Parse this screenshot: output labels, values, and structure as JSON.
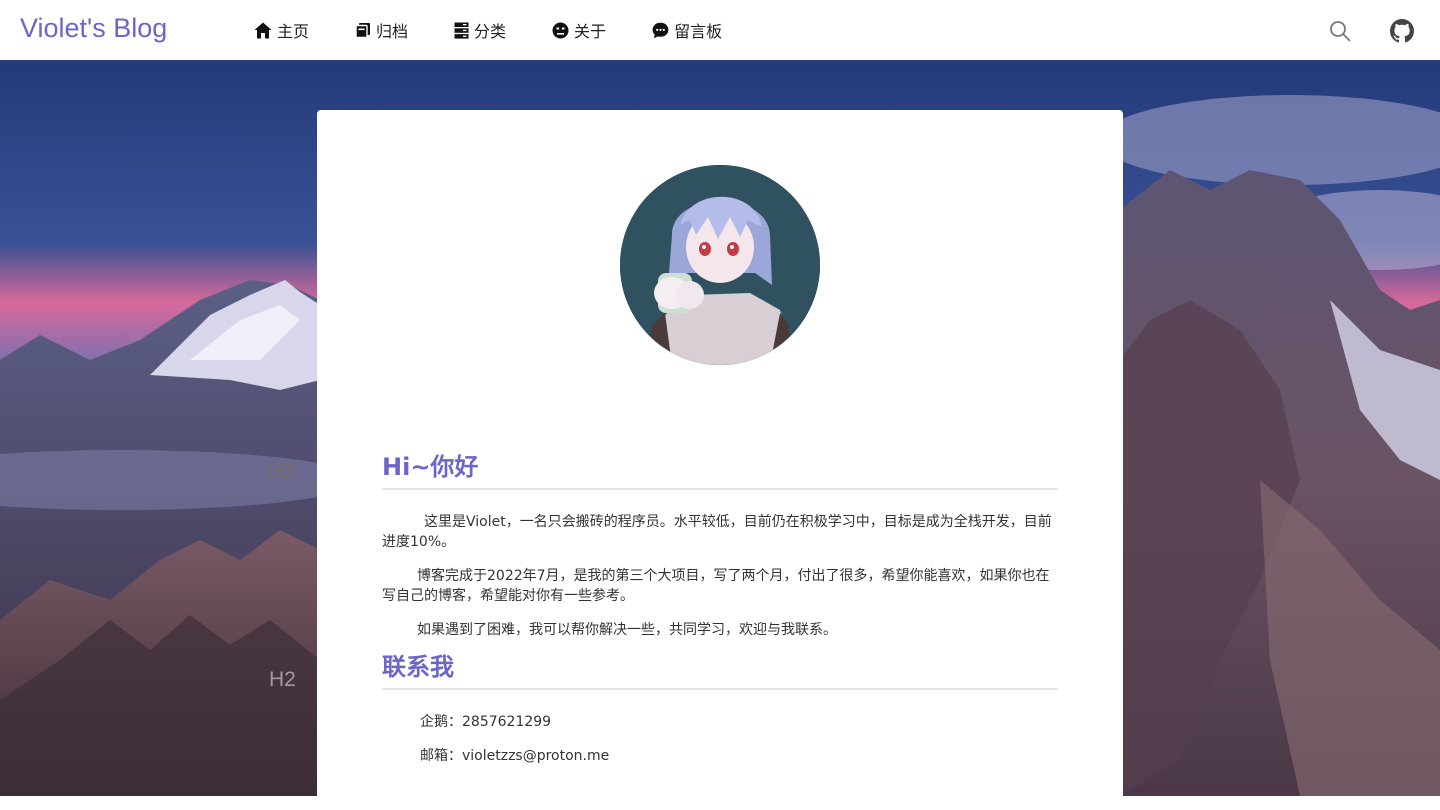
{
  "site": {
    "brand": "Violet's Blog",
    "accent_color": "#6d66c9"
  },
  "nav": {
    "items": [
      {
        "label": "主页",
        "icon": "home-icon"
      },
      {
        "label": "归档",
        "icon": "archive-icon"
      },
      {
        "label": "分类",
        "icon": "category-icon"
      },
      {
        "label": "关于",
        "icon": "face-icon"
      },
      {
        "label": "留言板",
        "icon": "chat-icon"
      }
    ],
    "right_icons": [
      "search-icon",
      "github-icon"
    ]
  },
  "background": {
    "side_headings": [
      "H2",
      "H2"
    ]
  },
  "card": {
    "avatar": "anime-character-avatar",
    "intro": {
      "title": "Hi~你好",
      "paragraphs": [
        "这里是Violet，一名只会搬砖的程序员。水平较低，目前仍在积极学习中，目标是成为全栈开发，目前进度10%。",
        "博客完成于2022年7月，是我的第三个大项目，写了两个月，付出了很多，希望你能喜欢，如果你也在写自己的博客，希望能对你有一些参考。",
        "如果遇到了困难，我可以帮你解决一些，共同学习，欢迎与我联系。"
      ]
    },
    "contact": {
      "title": "联系我",
      "lines": [
        "企鹅：2857621299",
        "邮箱：violetzzs@proton.me"
      ]
    }
  }
}
